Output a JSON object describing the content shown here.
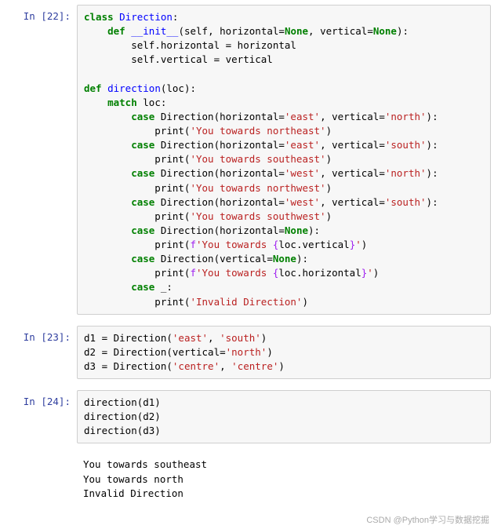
{
  "cells": [
    {
      "prompt": "In [22]:",
      "tokens": [
        [
          "k",
          "class"
        ],
        [
          "n",
          " "
        ],
        [
          "nf",
          "Direction"
        ],
        [
          "p",
          ":"
        ],
        [
          "n",
          "\n    "
        ],
        [
          "k",
          "def"
        ],
        [
          "n",
          " "
        ],
        [
          "nf",
          "__init__"
        ],
        [
          "p",
          "("
        ],
        [
          "n",
          "self"
        ],
        [
          "p",
          ", "
        ],
        [
          "n",
          "horizontal"
        ],
        [
          "p",
          "="
        ],
        [
          "bp",
          "None"
        ],
        [
          "p",
          ", "
        ],
        [
          "n",
          "vertical"
        ],
        [
          "p",
          "="
        ],
        [
          "bp",
          "None"
        ],
        [
          "p",
          "):"
        ],
        [
          "n",
          "\n        self.horizontal = horizontal\n        self.vertical = vertical\n\n"
        ],
        [
          "k",
          "def"
        ],
        [
          "n",
          " "
        ],
        [
          "nf",
          "direction"
        ],
        [
          "p",
          "("
        ],
        [
          "n",
          "loc"
        ],
        [
          "p",
          "):"
        ],
        [
          "n",
          "\n    "
        ],
        [
          "k",
          "match"
        ],
        [
          "n",
          " loc:\n        "
        ],
        [
          "k",
          "case"
        ],
        [
          "n",
          " Direction(horizontal="
        ],
        [
          "s",
          "'east'"
        ],
        [
          "n",
          ", vertical="
        ],
        [
          "s",
          "'north'"
        ],
        [
          "p",
          "):"
        ],
        [
          "n",
          "\n            print("
        ],
        [
          "s",
          "'You towards northeast'"
        ],
        [
          "p",
          ")"
        ],
        [
          "n",
          "\n        "
        ],
        [
          "k",
          "case"
        ],
        [
          "n",
          " Direction(horizontal="
        ],
        [
          "s",
          "'east'"
        ],
        [
          "n",
          ", vertical="
        ],
        [
          "s",
          "'south'"
        ],
        [
          "p",
          "):"
        ],
        [
          "n",
          "\n            print("
        ],
        [
          "s",
          "'You towards southeast'"
        ],
        [
          "p",
          ")"
        ],
        [
          "n",
          "\n        "
        ],
        [
          "k",
          "case"
        ],
        [
          "n",
          " Direction(horizontal="
        ],
        [
          "s",
          "'west'"
        ],
        [
          "n",
          ", vertical="
        ],
        [
          "s",
          "'north'"
        ],
        [
          "p",
          "):"
        ],
        [
          "n",
          "\n            print("
        ],
        [
          "s",
          "'You towards northwest'"
        ],
        [
          "p",
          ")"
        ],
        [
          "n",
          "\n        "
        ],
        [
          "k",
          "case"
        ],
        [
          "n",
          " Direction(horizontal="
        ],
        [
          "s",
          "'west'"
        ],
        [
          "n",
          ", vertical="
        ],
        [
          "s",
          "'south'"
        ],
        [
          "p",
          "):"
        ],
        [
          "n",
          "\n            print("
        ],
        [
          "s",
          "'You towards southwest'"
        ],
        [
          "p",
          ")"
        ],
        [
          "n",
          "\n        "
        ],
        [
          "k",
          "case"
        ],
        [
          "n",
          " Direction(horizontal="
        ],
        [
          "bp",
          "None"
        ],
        [
          "p",
          "):"
        ],
        [
          "n",
          "\n            print("
        ],
        [
          "sk",
          "f"
        ],
        [
          "s",
          "'You towards "
        ],
        [
          "sk",
          "{"
        ],
        [
          "n",
          "loc.vertical"
        ],
        [
          "sk",
          "}"
        ],
        [
          "s",
          "'"
        ],
        [
          "p",
          ")"
        ],
        [
          "n",
          "\n        "
        ],
        [
          "k",
          "case"
        ],
        [
          "n",
          " Direction(vertical="
        ],
        [
          "bp",
          "None"
        ],
        [
          "p",
          "):"
        ],
        [
          "n",
          "\n            print("
        ],
        [
          "sk",
          "f"
        ],
        [
          "s",
          "'You towards "
        ],
        [
          "sk",
          "{"
        ],
        [
          "n",
          "loc.horizontal"
        ],
        [
          "sk",
          "}"
        ],
        [
          "s",
          "'"
        ],
        [
          "p",
          ")"
        ],
        [
          "n",
          "\n        "
        ],
        [
          "k",
          "case"
        ],
        [
          "n",
          " _:\n            print("
        ],
        [
          "s",
          "'Invalid Direction'"
        ],
        [
          "p",
          ")"
        ]
      ]
    },
    {
      "prompt": "In [23]:",
      "tokens": [
        [
          "n",
          "d1 = Direction("
        ],
        [
          "s",
          "'east'"
        ],
        [
          "p",
          ", "
        ],
        [
          "s",
          "'south'"
        ],
        [
          "p",
          ")"
        ],
        [
          "n",
          "\n"
        ],
        [
          "n",
          "d2 = Direction(vertical="
        ],
        [
          "s",
          "'north'"
        ],
        [
          "p",
          ")"
        ],
        [
          "n",
          "\n"
        ],
        [
          "n",
          "d3 = Direction("
        ],
        [
          "s",
          "'centre'"
        ],
        [
          "p",
          ", "
        ],
        [
          "s",
          "'centre'"
        ],
        [
          "p",
          ")"
        ]
      ]
    },
    {
      "prompt": "In [24]:",
      "tokens": [
        [
          "n",
          "direction(d1)\ndirection(d2)\ndirection(d3)"
        ]
      ],
      "output": "You towards southeast\nYou towards north\nInvalid Direction"
    }
  ],
  "watermark": "CSDN @Python学习与数据挖掘"
}
